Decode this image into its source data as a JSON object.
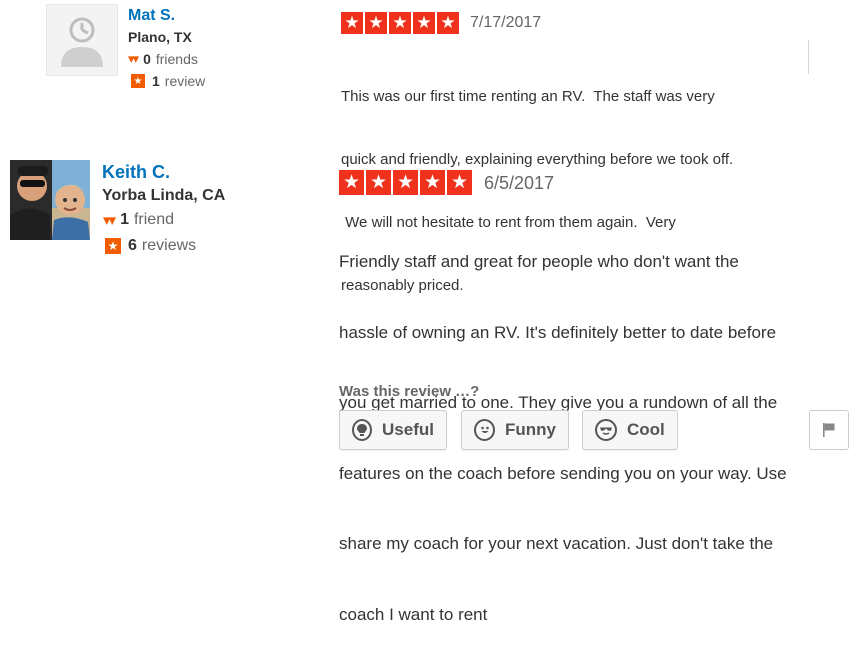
{
  "colors": {
    "link": "#0073bb",
    "star": "#f0321d",
    "accent": "#f15c00"
  },
  "reviews": [
    {
      "user": {
        "name": "Mat S.",
        "location": "Plano, TX",
        "friends_count": "0",
        "friends_label": "friends",
        "reviews_count": "1",
        "reviews_label": "review",
        "avatar": "default-avatar-icon"
      },
      "rating": 5,
      "date": "7/17/2017",
      "text_lines": [
        "This was our first time renting an RV.  The staff was very",
        "quick and friendly, explaining everything before we took off.",
        " We will not hesitate to rent from them again.  Very",
        "reasonably priced."
      ]
    },
    {
      "user": {
        "name": "Keith C.",
        "location": "Yorba Linda, CA",
        "friends_count": "1",
        "friends_label": "friend",
        "reviews_count": "6",
        "reviews_label": "reviews",
        "avatar": "user-photo"
      },
      "rating": 5,
      "date": "6/5/2017",
      "text_lines": [
        "Friendly staff and great for people who don't want the",
        "hassle of owning an RV. It's definitely better to date before",
        "you get married to one. They give you a rundown of all the",
        "features on the coach before sending you on your way. Use",
        "share my coach for your next vacation. Just don't take the",
        "coach I want to rent"
      ]
    }
  ],
  "feedback": {
    "prompt": "Was this review …?",
    "buttons": [
      {
        "label": "Useful",
        "icon": "lightbulb-icon"
      },
      {
        "label": "Funny",
        "icon": "smiley-icon"
      },
      {
        "label": "Cool",
        "icon": "sunglasses-icon"
      }
    ],
    "flag_icon": "flag-icon"
  }
}
